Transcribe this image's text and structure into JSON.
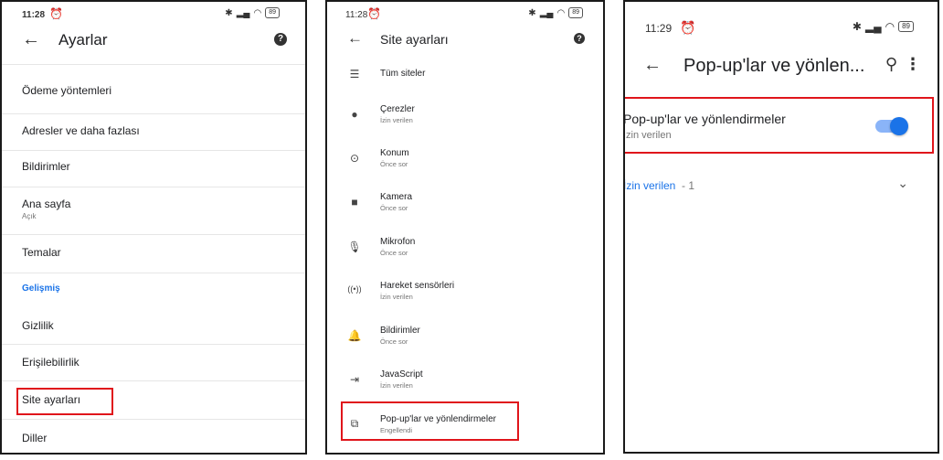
{
  "status": {
    "p1_time": "11:28",
    "p2_time": "11:28",
    "p3_time": "11:29",
    "battery": "89"
  },
  "panel1": {
    "title": "Ayarlar",
    "items": [
      {
        "label": "Ödeme yöntemleri"
      },
      {
        "label": "Adresler ve daha fazlası"
      },
      {
        "label": "Bildirimler"
      },
      {
        "label": "Ana sayfa",
        "sub": "Açık"
      },
      {
        "label": "Temalar"
      },
      {
        "label": "Gelişmiş"
      },
      {
        "label": "Gizlilik"
      },
      {
        "label": "Erişilebilirlik"
      },
      {
        "label": "Site ayarları"
      },
      {
        "label": "Diller"
      }
    ]
  },
  "panel2": {
    "title": "Site ayarları",
    "items": [
      {
        "label": "Tüm siteler",
        "icon": "list-icon"
      },
      {
        "label": "Çerezler",
        "sub": "İzin verilen",
        "icon": "cookie-icon"
      },
      {
        "label": "Konum",
        "sub": "Önce sor",
        "icon": "location-icon"
      },
      {
        "label": "Kamera",
        "sub": "Önce sor",
        "icon": "camera-icon"
      },
      {
        "label": "Mikrofon",
        "sub": "Önce sor",
        "icon": "microphone-icon"
      },
      {
        "label": "Hareket sensörleri",
        "sub": "İzin verilen",
        "icon": "motion-sensor-icon"
      },
      {
        "label": "Bildirimler",
        "sub": "Önce sor",
        "icon": "bell-icon"
      },
      {
        "label": "JavaScript",
        "sub": "İzin verilen",
        "icon": "javascript-icon"
      },
      {
        "label": "Pop-up'lar ve yönlendirmeler",
        "sub": "Engellendi",
        "icon": "popup-icon"
      }
    ]
  },
  "panel3": {
    "title": "Pop-up'lar ve yönlen...",
    "toggle_label": "Pop-up'lar ve yönlendirmeler",
    "toggle_sub": "İzin verilen",
    "toggle_on": true,
    "allowed_label": "İzin verilen",
    "allowed_count": " - 1"
  },
  "colors": {
    "accent": "#1a73e8",
    "highlight": "#e0151b"
  }
}
